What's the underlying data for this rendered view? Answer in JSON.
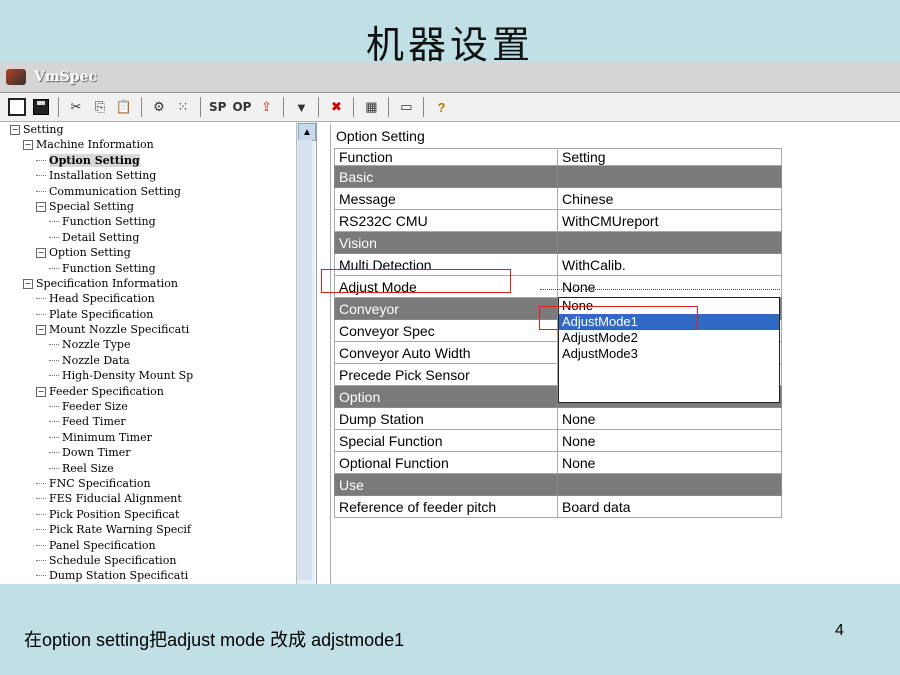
{
  "slide": {
    "title": "机器设置",
    "caption": "在option setting把adjust mode 改成 adjstmode1",
    "page_number": "4"
  },
  "app": {
    "title": "VmSpec",
    "toolbar": {
      "sp_label": "SP",
      "op_label": "OP"
    }
  },
  "tree": {
    "items": [
      {
        "label": "Setting",
        "level": 0,
        "expander": "−"
      },
      {
        "label": "Machine Information",
        "level": 1,
        "expander": "−"
      },
      {
        "label": "Option Setting",
        "level": 2,
        "selected": true
      },
      {
        "label": "Installation Setting",
        "level": 2
      },
      {
        "label": "Communication Setting",
        "level": 2
      },
      {
        "label": "Special Setting",
        "level": 2,
        "expander": "−"
      },
      {
        "label": "Function Setting",
        "level": 3
      },
      {
        "label": "Detail Setting",
        "level": 3
      },
      {
        "label": "Option Setting",
        "level": 2,
        "expander": "−"
      },
      {
        "label": "Function Setting",
        "level": 3
      },
      {
        "label": "Specification Information",
        "level": 1,
        "expander": "−"
      },
      {
        "label": "Head Specification",
        "level": 2
      },
      {
        "label": "Plate Specification",
        "level": 2
      },
      {
        "label": "Mount Nozzle Specificati",
        "level": 2,
        "expander": "−"
      },
      {
        "label": "Nozzle Type",
        "level": 3
      },
      {
        "label": "Nozzle Data",
        "level": 3
      },
      {
        "label": "High-Density Mount Sp",
        "level": 3
      },
      {
        "label": "Feeder Specification",
        "level": 2,
        "expander": "−"
      },
      {
        "label": "Feeder Size",
        "level": 3
      },
      {
        "label": "Feed Timer",
        "level": 3
      },
      {
        "label": "Minimum Timer",
        "level": 3
      },
      {
        "label": "Down Timer",
        "level": 3
      },
      {
        "label": "Reel Size",
        "level": 3
      },
      {
        "label": "FNC Specification",
        "level": 2
      },
      {
        "label": "FES Fiducial Alignment",
        "level": 2
      },
      {
        "label": "Pick Position Specificat",
        "level": 2
      },
      {
        "label": "Pick Rate Warning Specif",
        "level": 2
      },
      {
        "label": "Panel Specification",
        "level": 2
      },
      {
        "label": "Schedule Specification",
        "level": 2
      },
      {
        "label": "Dump Station Specificati",
        "level": 2
      }
    ]
  },
  "panel": {
    "title": "Option Setting",
    "headers": {
      "function": "Function",
      "setting": "Setting"
    },
    "rows": [
      {
        "function": "Basic",
        "setting": "",
        "category": true
      },
      {
        "function": "Message",
        "setting": "Chinese"
      },
      {
        "function": "RS232C CMU",
        "setting": "WithCMUreport"
      },
      {
        "function": "Vision",
        "setting": "",
        "category": true
      },
      {
        "function": "Multi Detection",
        "setting": "WithCalib."
      },
      {
        "function": "Adjust Mode",
        "setting": "None"
      },
      {
        "function": "Conveyor",
        "setting": "",
        "category": true
      },
      {
        "function": "Conveyor Spec",
        "setting": ""
      },
      {
        "function": "Conveyor Auto Width",
        "setting": ""
      },
      {
        "function": "Precede Pick Sensor",
        "setting": ""
      },
      {
        "function": "Option",
        "setting": "",
        "category": true
      },
      {
        "function": "Dump Station",
        "setting": "None"
      },
      {
        "function": "Special Function",
        "setting": "None"
      },
      {
        "function": "Optional Function",
        "setting": "None"
      },
      {
        "function": "Use",
        "setting": "",
        "category": true
      },
      {
        "function": "Reference of feeder pitch",
        "setting": "Board data"
      }
    ],
    "dropdown": {
      "options": [
        "None",
        "AdjustMode1",
        "AdjustMode2",
        "AdjustMode3"
      ],
      "highlighted": "AdjustMode1"
    }
  },
  "colors": {
    "slide_bg": "#c0e0e6",
    "category_row": "#7a7a7a",
    "selection": "#3169c6",
    "annotation": "#e02020"
  }
}
